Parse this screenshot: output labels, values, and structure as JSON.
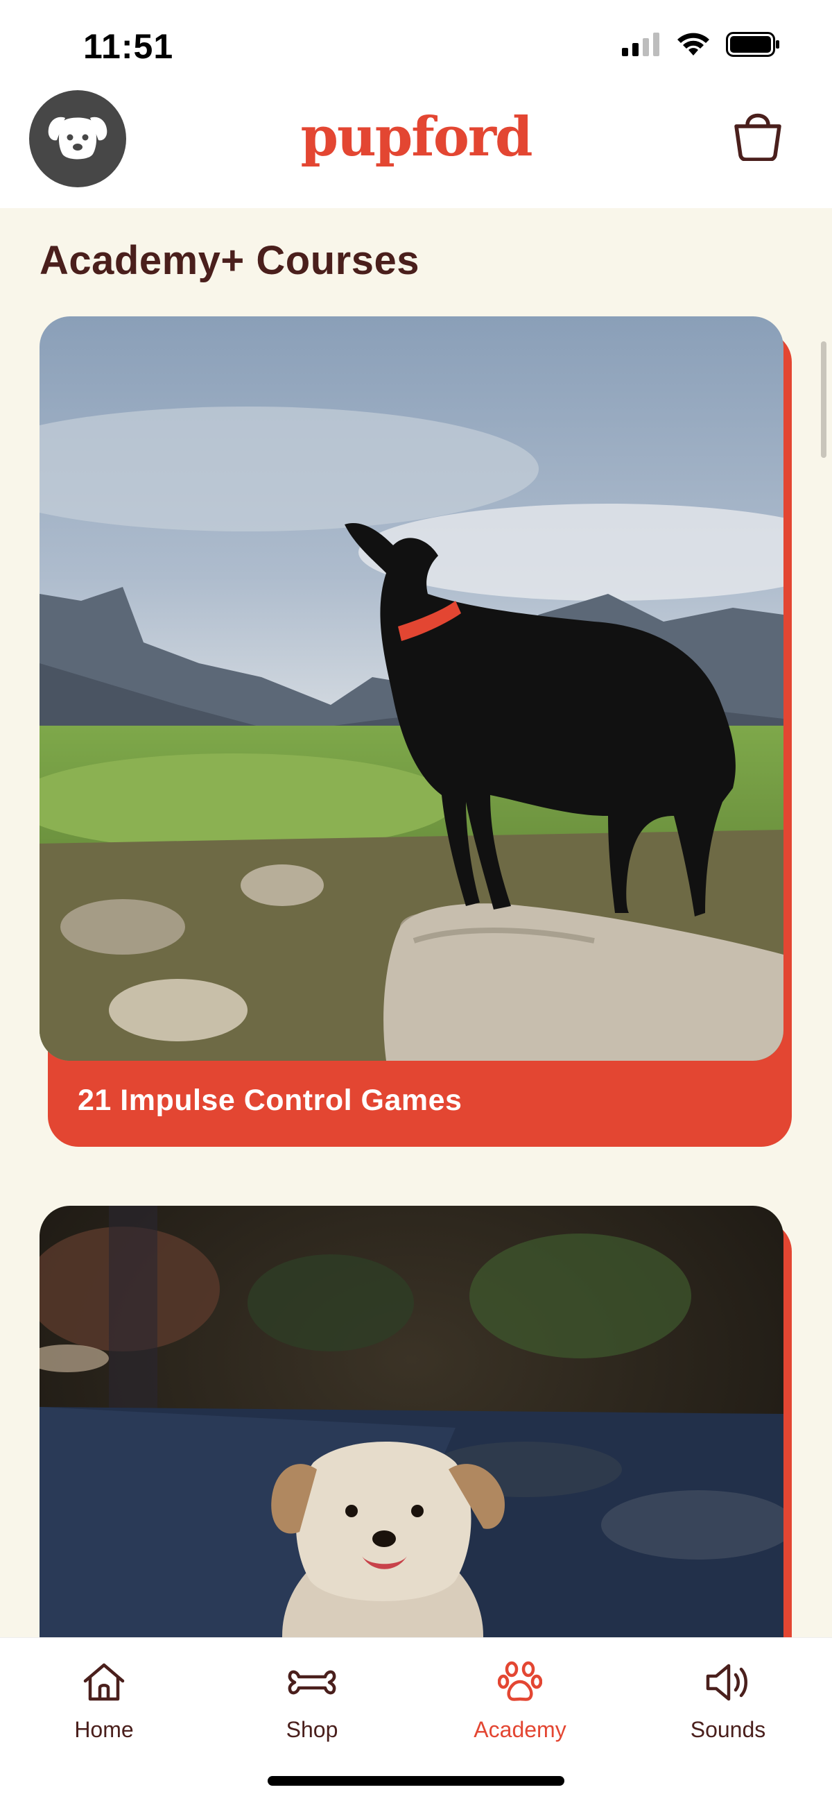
{
  "status_bar": {
    "time": "11:51"
  },
  "header": {
    "brand": "pupford",
    "avatar_icon": "dog-face-icon",
    "cart_icon": "shopping-bag-icon"
  },
  "main": {
    "title": "Academy+ Courses",
    "courses": [
      {
        "title": "21 Impulse Control Games",
        "image": "black-dog-on-rock-mountains"
      },
      {
        "title": "",
        "image": "fluffy-puppy-on-path"
      }
    ]
  },
  "tab_bar": {
    "tabs": [
      {
        "label": "Home",
        "icon": "home-icon",
        "active": false
      },
      {
        "label": "Shop",
        "icon": "bone-icon",
        "active": false
      },
      {
        "label": "Academy",
        "icon": "paw-icon",
        "active": true
      },
      {
        "label": "Sounds",
        "icon": "speaker-icon",
        "active": false
      }
    ]
  },
  "colors": {
    "brand": "#e34632",
    "text_dark": "#4a1f1c",
    "background": "#f9f6ea",
    "avatar_bg": "#474747"
  }
}
